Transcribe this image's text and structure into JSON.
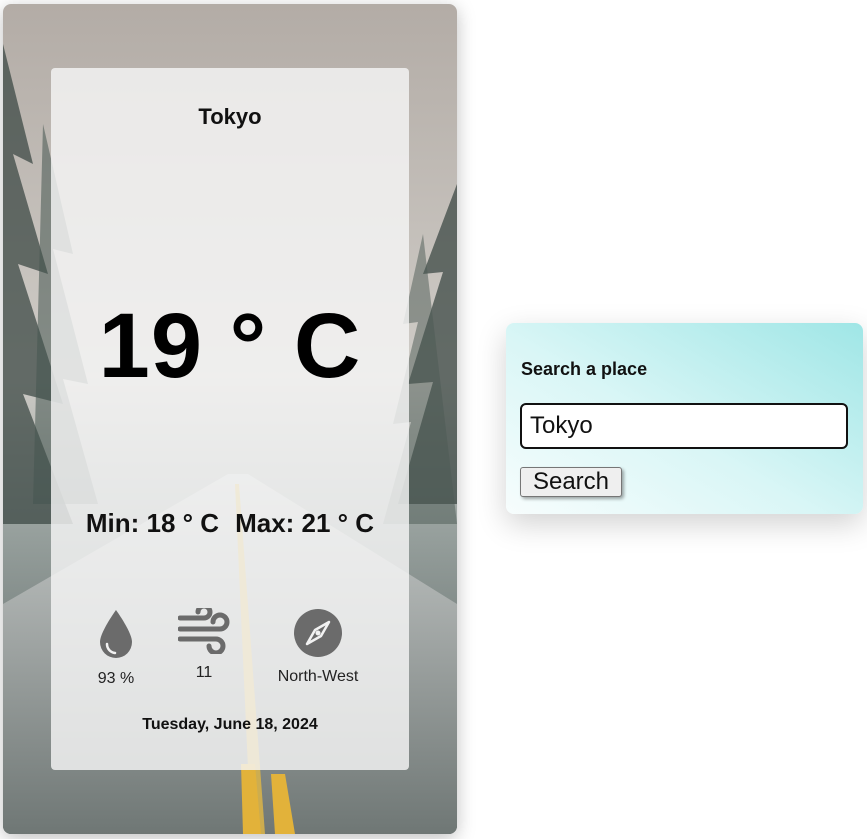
{
  "weather": {
    "city": "Tokyo",
    "temperature": "19 ° C",
    "min_label": "Min: 18 ° C",
    "max_label": "Max: 21 ° C",
    "humidity": "93 %",
    "wind": "11",
    "direction": "North-West",
    "date": "Tuesday, June 18, 2024",
    "icons": [
      "droplet-icon",
      "wind-icon",
      "compass-icon"
    ]
  },
  "search": {
    "title": "Search a place",
    "input_value": "Tokyo",
    "button_label": "Search"
  },
  "colors": {
    "panel_accent": "#9fe6e6",
    "icon_gray": "#6b6b6b"
  }
}
